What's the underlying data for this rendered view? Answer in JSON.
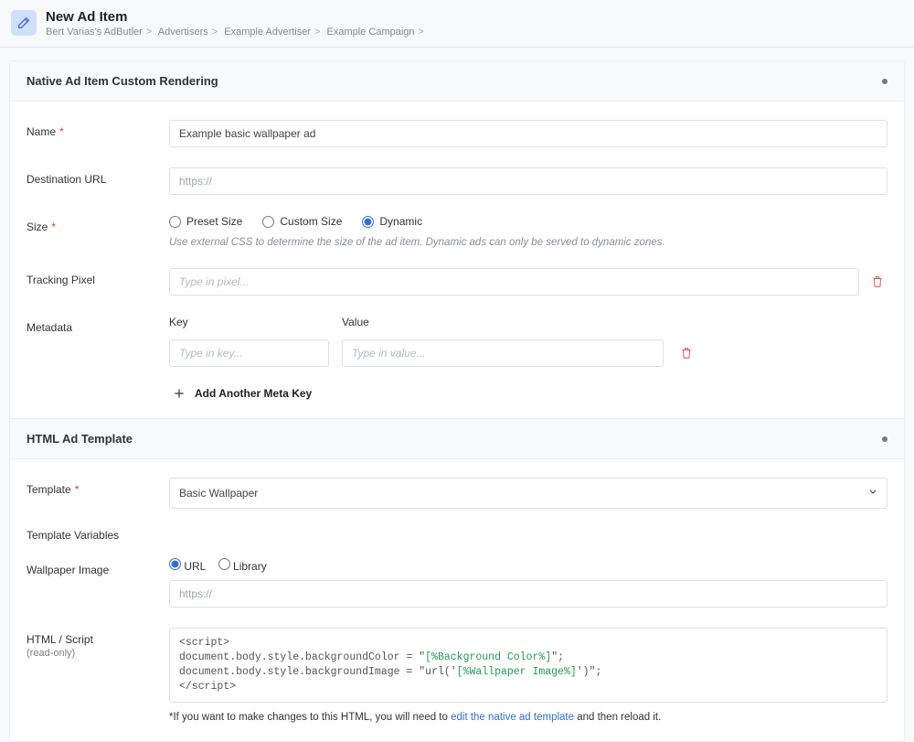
{
  "header": {
    "title": "New Ad Item",
    "breadcrumbs": [
      "Bert Varias's AdButler",
      "Advertisers",
      "Example Advertiser",
      "Example Campaign",
      ""
    ]
  },
  "section1": {
    "title": "Native Ad Item Custom Rendering",
    "name_label": "Name",
    "name_value": "Example basic wallpaper ad",
    "dest_label": "Destination URL",
    "dest_placeholder": "https://",
    "size_label": "Size",
    "size_options": {
      "preset": "Preset Size",
      "custom": "Custom Size",
      "dynamic": "Dynamic"
    },
    "size_hint": "Use external CSS to determine the size of the ad item. Dynamic ads can only be served to dynamic zones.",
    "tracking_label": "Tracking Pixel",
    "tracking_placeholder": "Type in pixel...",
    "metadata_label": "Metadata",
    "metadata_key_label": "Key",
    "metadata_val_label": "Value",
    "metadata_key_placeholder": "Type in key...",
    "metadata_val_placeholder": "Type in value...",
    "add_another": "Add Another Meta Key"
  },
  "section2": {
    "title": "HTML Ad Template",
    "template_label": "Template",
    "template_value": "Basic Wallpaper",
    "tvar_heading": "Template Variables",
    "wallpaper_label": "Wallpaper Image",
    "wallpaper_opts": {
      "url": "URL",
      "library": "Library"
    },
    "wallpaper_placeholder": "https://",
    "html_label": "HTML / Script",
    "html_sub": "(read-only)",
    "code_opening": "<script>",
    "code_line1a": "document.body.style.backgroundColor = \"",
    "code_line1b": "[%Background Color%]",
    "code_line1c": "\";",
    "code_line2a": "document.body.style.backgroundImage = \"url('",
    "code_line2b": "[%Wallpaper Image%]",
    "code_line2c": "')\";",
    "code_closing": "</scr",
    "code_closing2": "ipt>",
    "footnote_a": "*If you want to make changes to this HTML, you will need to ",
    "footnote_link": "edit the native ad template",
    "footnote_b": " and then reload it."
  }
}
